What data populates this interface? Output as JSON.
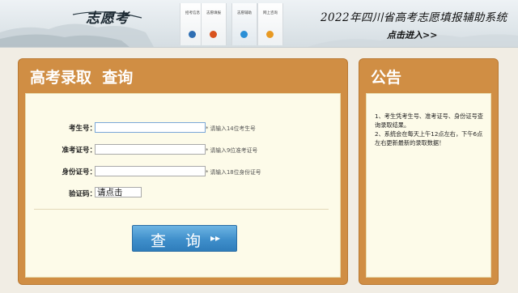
{
  "banner": {
    "logo": "志愿考",
    "title": "2022年四川省高考志愿填报辅助系统",
    "enter_link": "点击进入>>",
    "nav_tiles": [
      {
        "label": "招考信息",
        "color": "#2f6fb3",
        "icon": "info-dot-icon"
      },
      {
        "label": "志愿填报",
        "color": "#d9531e",
        "icon": "form-dot-icon"
      },
      {
        "label": "志愿辅助",
        "color": "#2a8fd6",
        "icon": "assist-dot-icon"
      },
      {
        "label": "网上咨询",
        "color": "#e89a23",
        "icon": "consult-dot-icon"
      }
    ]
  },
  "main": {
    "title": "高考录取  查询",
    "fields": [
      {
        "label": "考生号：",
        "value": "",
        "hint": "* 请输入14位考生号"
      },
      {
        "label": "准考证号：",
        "value": "",
        "hint": "* 请输入9位准考证号"
      },
      {
        "label": "身份证号：",
        "value": "",
        "hint": "* 请输入18位身份证号"
      }
    ],
    "captcha_label": "验证码：",
    "captcha_value": "请点击",
    "submit_label": "查 询",
    "submit_arrow": "▸▸"
  },
  "notice": {
    "title": "公告",
    "line1": "1、考生凭考生号、准考证号、身份证号查询录取结果。",
    "line2": "2、系统会在每天上午12点左右，下午6点左右更新最新的录取数据！"
  },
  "colors": {
    "panel_orange": "#d08e44",
    "panel_inner": "#fdfbe9",
    "button_blue": "#3f8fcb",
    "page_bg": "#f1ede4"
  }
}
